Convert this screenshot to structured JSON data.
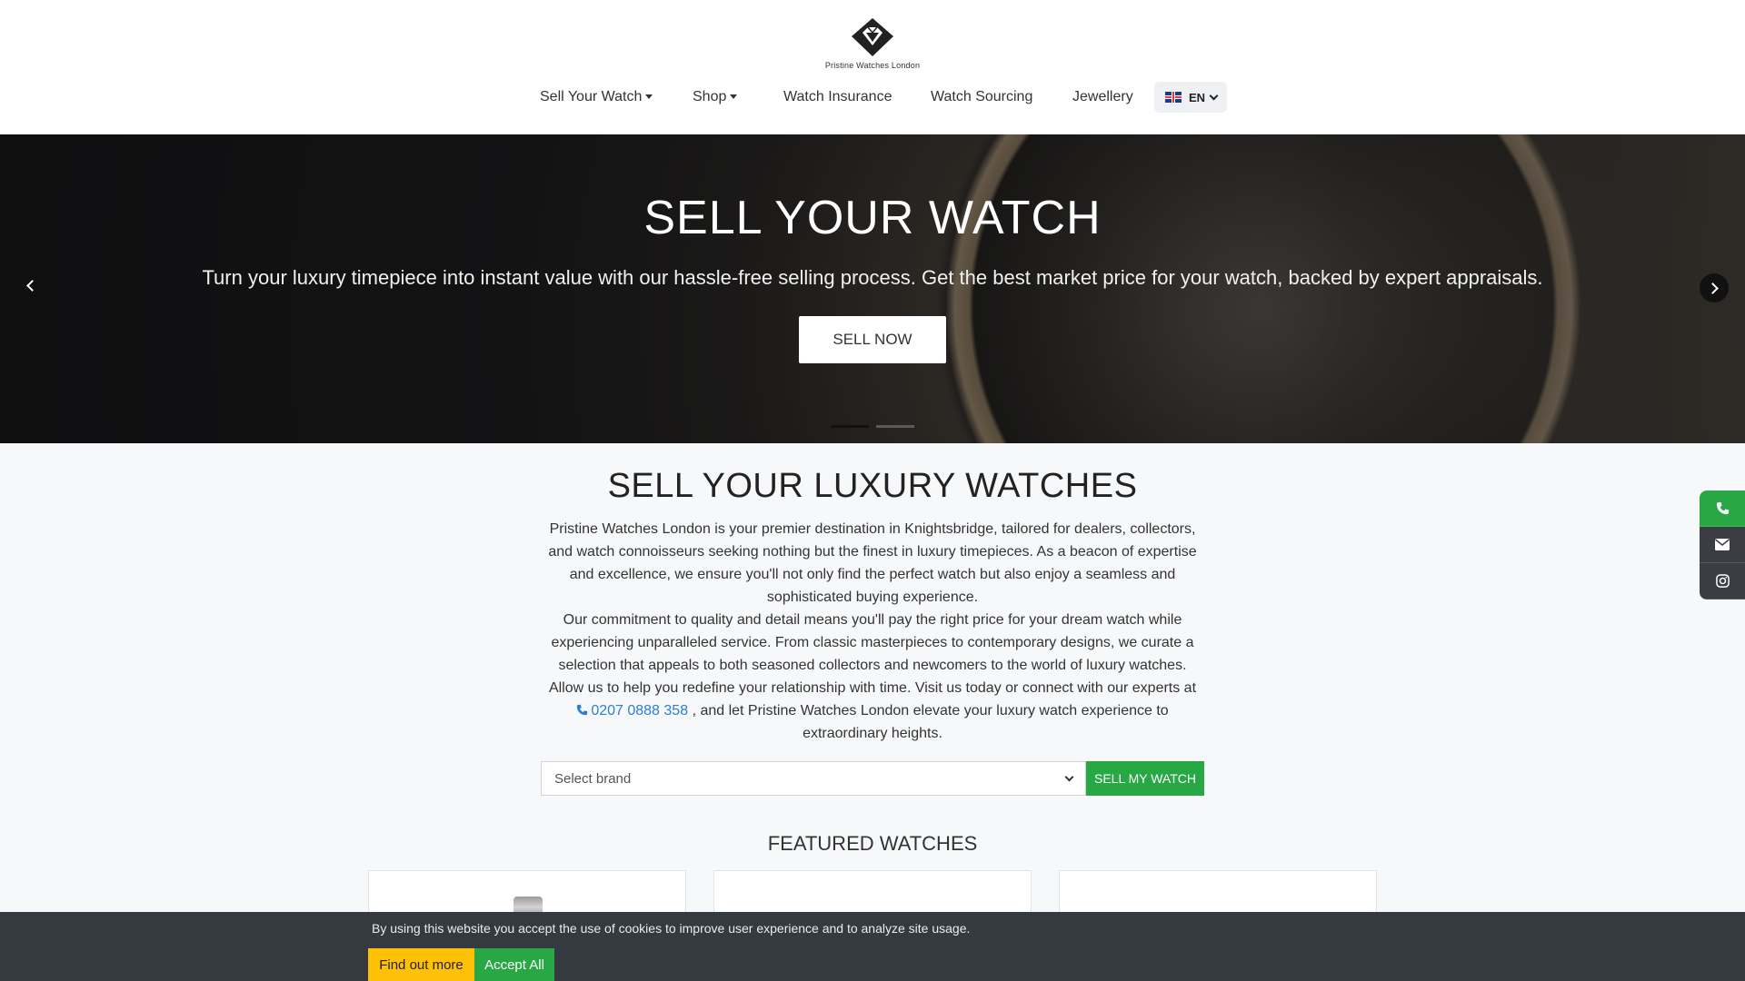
{
  "header": {
    "logo_text": "Pristine Watches London",
    "nav": [
      {
        "label": "Sell Your Watch",
        "dropdown": true
      },
      {
        "label": "Shop",
        "dropdown": true
      },
      {
        "label": "Watch Insurance",
        "dropdown": false
      },
      {
        "label": "Watch Sourcing",
        "dropdown": false
      },
      {
        "label": "Jewellery",
        "dropdown": false
      }
    ],
    "language": {
      "label": "EN",
      "flag": "uk-flag-icon"
    }
  },
  "hero": {
    "title": "SELL YOUR WATCH",
    "subtitle": "Turn your luxury timepiece into instant value with our hassle-free selling process. Get the best market price for your watch, backed by expert appraisals.",
    "cta_label": "SELL NOW",
    "prev_icon": "chevron-left-icon",
    "next_icon": "chevron-right-icon",
    "active_slide": 1,
    "slide_count": 2
  },
  "main": {
    "title": "SELL YOUR LUXURY WATCHES",
    "paragraph_1": "Pristine Watches London is your premier destination in Knightsbridge, tailored for dealers, collectors, and watch connoisseurs seeking nothing but the finest in luxury timepieces. As a beacon of expertise and excellence, we ensure you'll not only find the perfect watch but also enjoy a seamless and sophisticated buying experience.",
    "paragraph_2": "Our commitment to quality and detail means you'll pay the right price for your dream watch while experiencing unparalleled service. From classic masterpieces to contemporary designs, we curate a selection that appeals to both seasoned collectors and newcomers to the world of luxury watches. Allow us to help you redefine your relationship with time. Visit us today or connect with our experts at",
    "phone": "0207 0888 358",
    "paragraph_3": ", and let Pristine Watches London elevate your luxury watch experience to extraordinary heights.",
    "brand_select": {
      "selected": "Select brand"
    },
    "sell_button": "SELL MY WATCH",
    "featured_title": "FEATURED WATCHES"
  },
  "social": [
    {
      "icon": "phone-icon",
      "color": "#28a745"
    },
    {
      "icon": "envelope-icon",
      "color": "#3a3d42"
    },
    {
      "icon": "instagram-icon",
      "color": "#3a3d42"
    }
  ],
  "cookie": {
    "text": "By using this website you accept the use of cookies to improve user experience and to analyze site usage.",
    "find_out_more": "Find out more",
    "accept_all": "Accept All"
  },
  "colors": {
    "accent_green": "#28a745",
    "cookie_yellow": "#ffc107",
    "link_blue": "#2a7fd4",
    "cookie_bar": "#343a40"
  }
}
